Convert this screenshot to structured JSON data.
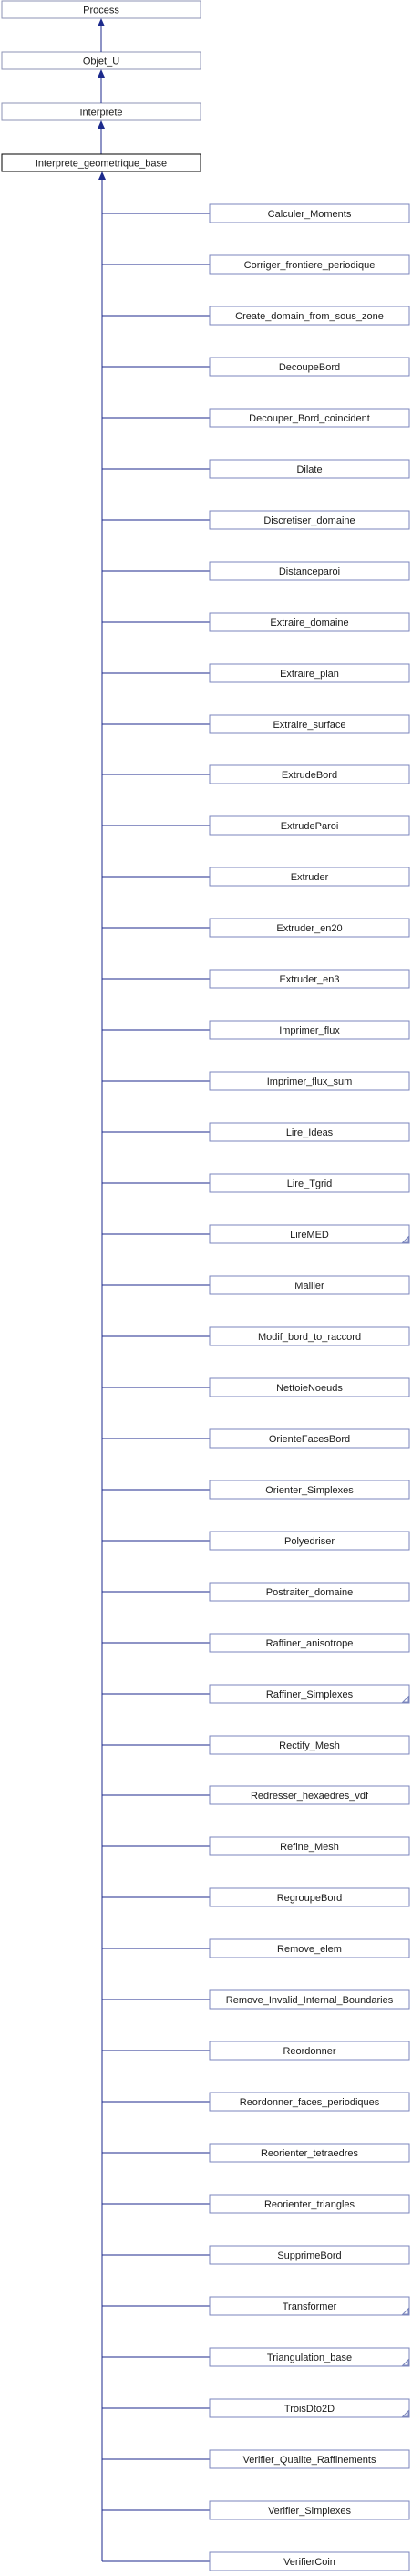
{
  "ancestors": [
    {
      "name": "Process"
    },
    {
      "name": "Objet_U"
    },
    {
      "name": "Interprete"
    }
  ],
  "root": {
    "name": "Interprete_geometrique_base"
  },
  "children": [
    {
      "name": "Calculer_Moments",
      "has_more": false
    },
    {
      "name": "Corriger_frontiere_periodique",
      "has_more": false
    },
    {
      "name": "Create_domain_from_sous_zone",
      "has_more": false
    },
    {
      "name": "DecoupeBord",
      "has_more": false
    },
    {
      "name": "Decouper_Bord_coincident",
      "has_more": false
    },
    {
      "name": "Dilate",
      "has_more": false
    },
    {
      "name": "Discretiser_domaine",
      "has_more": false
    },
    {
      "name": "Distanceparoi",
      "has_more": false
    },
    {
      "name": "Extraire_domaine",
      "has_more": false
    },
    {
      "name": "Extraire_plan",
      "has_more": false
    },
    {
      "name": "Extraire_surface",
      "has_more": false
    },
    {
      "name": "ExtrudeBord",
      "has_more": false
    },
    {
      "name": "ExtrudeParoi",
      "has_more": false
    },
    {
      "name": "Extruder",
      "has_more": false
    },
    {
      "name": "Extruder_en20",
      "has_more": false
    },
    {
      "name": "Extruder_en3",
      "has_more": false
    },
    {
      "name": "Imprimer_flux",
      "has_more": false
    },
    {
      "name": "Imprimer_flux_sum",
      "has_more": false
    },
    {
      "name": "Lire_Ideas",
      "has_more": false
    },
    {
      "name": "Lire_Tgrid",
      "has_more": false
    },
    {
      "name": "LireMED",
      "has_more": true
    },
    {
      "name": "Mailler",
      "has_more": false
    },
    {
      "name": "Modif_bord_to_raccord",
      "has_more": false
    },
    {
      "name": "NettoieNoeuds",
      "has_more": false
    },
    {
      "name": "OrienteFacesBord",
      "has_more": false
    },
    {
      "name": "Orienter_Simplexes",
      "has_more": false
    },
    {
      "name": "Polyedriser",
      "has_more": false
    },
    {
      "name": "Postraiter_domaine",
      "has_more": false
    },
    {
      "name": "Raffiner_anisotrope",
      "has_more": false
    },
    {
      "name": "Raffiner_Simplexes",
      "has_more": true
    },
    {
      "name": "Rectify_Mesh",
      "has_more": false
    },
    {
      "name": "Redresser_hexaedres_vdf",
      "has_more": false
    },
    {
      "name": "Refine_Mesh",
      "has_more": false
    },
    {
      "name": "RegroupeBord",
      "has_more": false
    },
    {
      "name": "Remove_elem",
      "has_more": false
    },
    {
      "name": "Remove_Invalid_Internal_Boundaries",
      "has_more": false
    },
    {
      "name": "Reordonner",
      "has_more": false
    },
    {
      "name": "Reordonner_faces_periodiques",
      "has_more": false
    },
    {
      "name": "Reorienter_tetraedres",
      "has_more": false
    },
    {
      "name": "Reorienter_triangles",
      "has_more": false
    },
    {
      "name": "SupprimeBord",
      "has_more": false
    },
    {
      "name": "Transformer",
      "has_more": true
    },
    {
      "name": "Triangulation_base",
      "has_more": true
    },
    {
      "name": "TroisDto2D",
      "has_more": true
    },
    {
      "name": "Verifier_Qualite_Raffinements",
      "has_more": false
    },
    {
      "name": "Verifier_Simplexes",
      "has_more": false
    },
    {
      "name": "VerifierCoin",
      "has_more": false
    }
  ],
  "colors": {
    "edge": "#1c2a8c",
    "ancestor_border": "#8c93b5",
    "child_border": "#7b86bd",
    "root_border": "#000000"
  }
}
